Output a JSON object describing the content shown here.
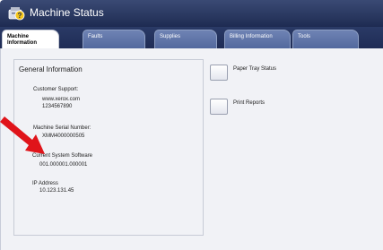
{
  "window": {
    "title": "Machine Status"
  },
  "tabs": [
    {
      "label_line1": "Machine",
      "label_line2": "Information",
      "active": true
    },
    {
      "label_line1": "Faults",
      "label_line2": "",
      "active": false
    },
    {
      "label_line1": "Supplies",
      "label_line2": "",
      "active": false
    },
    {
      "label_line1": "Billing Information",
      "label_line2": "",
      "active": false
    },
    {
      "label_line1": "Tools",
      "label_line2": "",
      "active": false
    }
  ],
  "general_info": {
    "heading": "General Information",
    "customer_support_label": "Customer Support:",
    "website": "www.xerox.com",
    "phone": "1234567890",
    "serial_label": "Machine Serial Number:",
    "serial_value": "XMM4000000505",
    "software_label": "Current System Software",
    "software_value": "001.000001.000001",
    "ip_label": "IP Address",
    "ip_value": "10.123.131.45"
  },
  "actions": [
    {
      "label": "Paper Tray Status"
    },
    {
      "label": "Print Reports"
    }
  ],
  "colors": {
    "titlebar": "#1e2b52",
    "tab_inactive": "#5a6fa3",
    "content_bg": "#f1f2f6",
    "arrow": "#e0141a"
  }
}
